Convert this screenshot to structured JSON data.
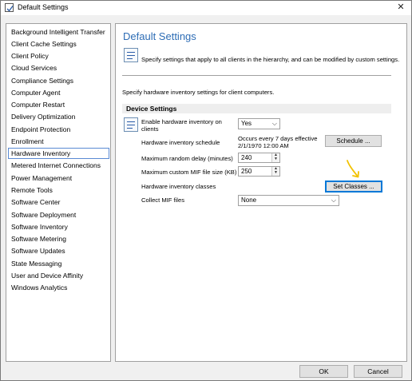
{
  "window": {
    "title": "Default Settings"
  },
  "nav": {
    "selected_index": 11,
    "items": [
      "Background Intelligent Transfer",
      "Client Cache Settings",
      "Client Policy",
      "Cloud Services",
      "Compliance Settings",
      "Computer Agent",
      "Computer Restart",
      "Delivery Optimization",
      "Endpoint Protection",
      "Enrollment",
      "Hardware Inventory",
      "Metered Internet Connections",
      "Power Management",
      "Remote Tools",
      "Software Center",
      "Software Deployment",
      "Software Inventory",
      "Software Metering",
      "Software Updates",
      "State Messaging",
      "User and Device Affinity",
      "Windows Analytics"
    ]
  },
  "main": {
    "title": "Default Settings",
    "description": "Specify settings that apply to all clients in the hierarchy, and can be modified by custom settings.",
    "hw_description": "Specify hardware inventory settings for client computers.",
    "section_title": "Device Settings",
    "settings": {
      "enable_label": "Enable hardware inventory on clients",
      "enable_value": "Yes",
      "schedule_label": "Hardware inventory schedule",
      "schedule_value_line1": "Occurs every 7 days effective",
      "schedule_value_line2": "2/1/1970 12:00 AM",
      "schedule_button": "Schedule ...",
      "delay_label": "Maximum random delay (minutes)",
      "delay_value": "240",
      "mif_size_label": "Maximum custom MIF file size (KB)",
      "mif_size_value": "250",
      "classes_label": "Hardware inventory classes",
      "classes_button": "Set Classes ...",
      "collect_mif_label": "Collect MIF files",
      "collect_mif_value": "None"
    }
  },
  "footer": {
    "ok_label": "OK",
    "cancel_label": "Cancel"
  },
  "colors": {
    "title_blue": "#2e6db5",
    "annotation_arrow": "#f2c200",
    "focus_border": "#0078d7"
  }
}
